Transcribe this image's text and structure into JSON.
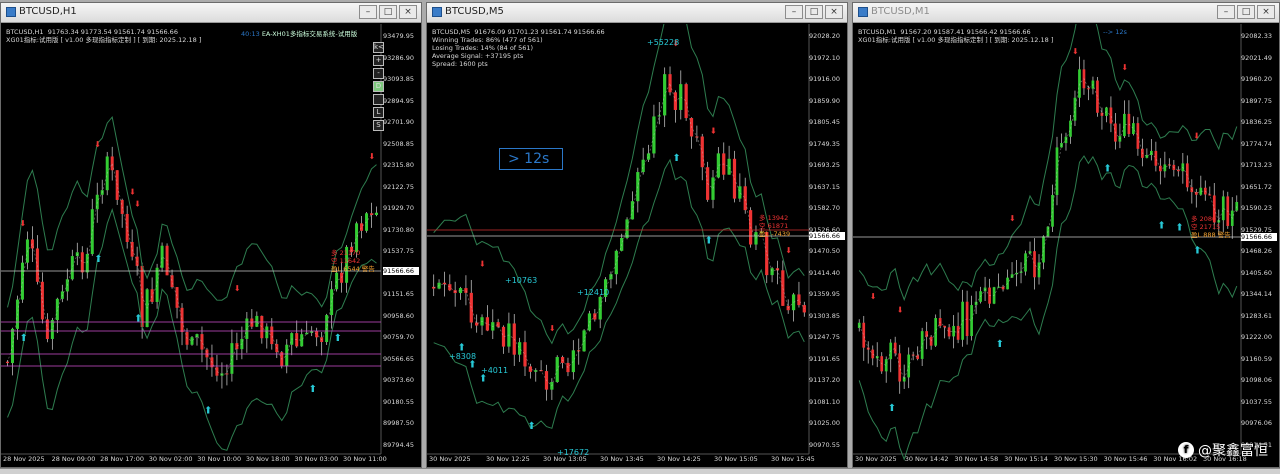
{
  "windows": [
    {
      "title": "BTCUSD,H1",
      "info": "BTCUSD,H1  91763.34 91773.54 91561.74 91566.66\nXG01指标:试用版 [ v1.00 多现指指标定制 ] [ 到期: 2025.12.18 ]",
      "ea": "EA-XH01多指标交易系统-试用版",
      "timer": "40:13",
      "y": [
        "93479.95",
        "93286.90",
        "93093.85",
        "92894.95",
        "92701.90",
        "92508.85",
        "92315.80",
        "92122.75",
        "91929.70",
        "91730.80",
        "91537.75",
        "91344.70",
        "91151.65",
        "90958.60",
        "90759.70",
        "90566.65",
        "90373.60",
        "90180.55",
        "89987.50",
        "89794.45"
      ],
      "x": [
        "28 Nov 2025",
        "28 Nov 09:00",
        "28 Nov 17:00",
        "30 Nov 02:00",
        "30 Nov 10:00",
        "30 Nov 18:00",
        "30 Nov 03:00",
        "30 Nov 11:00"
      ],
      "labels": [
        "多 21170",
        "空 11642",
        "盈L 6544 警告"
      ],
      "price": "91566.66",
      "tools": [
        "k<",
        "+",
        "-",
        "D",
        "",
        "L",
        "S"
      ]
    },
    {
      "title": "BTCUSD,M5",
      "info": "BTCUSD,M5  91676.09 91701.23 91561.74 91566.66\nWinning Trades: 86% (477 of 561)\nLosing Trades: 14% (84 of 561)\nAverage Signal: +37195 pts\nSpread: 1600 pts",
      "timer": "> 12s",
      "y": [
        "92028.20",
        "91972.10",
        "91916.00",
        "91859.90",
        "91805.45",
        "91749.35",
        "91693.25",
        "91637.15",
        "91582.70",
        "91526.60",
        "91470.50",
        "91414.40",
        "91359.95",
        "91303.85",
        "91247.75",
        "91191.65",
        "91137.20",
        "91081.10",
        "91025.00",
        "90970.55"
      ],
      "x": [
        "30 Nov 2025",
        "30 Nov 12:25",
        "30 Nov 13:05",
        "30 Nov 13:45",
        "30 Nov 14:25",
        "30 Nov 15:05",
        "30 Nov 15:45"
      ],
      "labels": [
        "多 13942",
        "空 61871",
        "盈L -7439"
      ],
      "price": "91566.66",
      "signals": [
        "+55228",
        "+10763",
        "+12410",
        "+8308",
        "+4011",
        "+17672"
      ]
    },
    {
      "title": "BTCUSD,M1",
      "info": "BTCUSD,M1  91567.20 91587.41 91566.42 91566.66\nXG01指标:试用版 [ v1.00 多现指指标定制 ] [ 到期: 2025.12.18 ]",
      "timer": "--> 12s",
      "y": [
        "92082.33",
        "92021.49",
        "91960.20",
        "91897.75",
        "91836.25",
        "91774.74",
        "91713.23",
        "91651.72",
        "91590.23",
        "91529.75",
        "91468.26",
        "91405.60",
        "91344.14",
        "91283.61",
        "91222.00",
        "91160.59",
        "91098.06",
        "91037.55",
        "90976.06",
        "90914.51"
      ],
      "x": [
        "30 Nov 2025",
        "30 Nov 14:42",
        "30 Nov 14:58",
        "30 Nov 15:14",
        "30 Nov 15:30",
        "30 Nov 15:46",
        "30 Nov 16:02",
        "30 Nov 16:18"
      ],
      "labels": [
        "多 2080",
        "空 21715",
        "盈L 888 警告"
      ],
      "price": "91566.66"
    }
  ],
  "watermark": "@聚鑫富恒",
  "colors": {
    "up": "#33cc33",
    "down": "#ee3333",
    "band": "#2e7d4f",
    "ma": "#c8c8c8",
    "signal": "#27c9d6"
  }
}
